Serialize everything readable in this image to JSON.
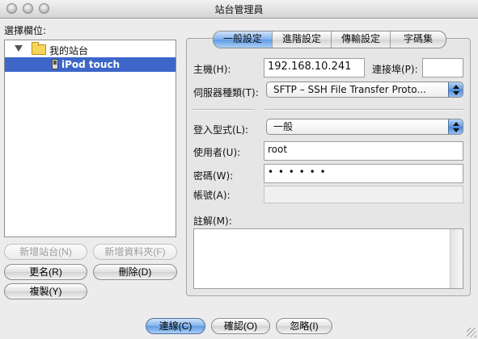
{
  "window": {
    "title": "站台管理員"
  },
  "left": {
    "select_entry_label": "選擇欄位:",
    "tree": [
      {
        "label": "我的站台",
        "icon": "folder-icon"
      },
      {
        "label": "iPod touch",
        "icon": "device-icon",
        "selected": true
      }
    ],
    "buttons": {
      "new_site": "新增站台(N)",
      "new_folder": "新增資料夾(F)",
      "rename": "更名(R)",
      "delete": "刪除(D)",
      "copy": "複製(Y)"
    }
  },
  "tabs": [
    "一般設定",
    "進階設定",
    "傳輸設定",
    "字碼集"
  ],
  "general": {
    "host_label": "主機(H):",
    "host_value": "192.168.10.241",
    "port_label": "連接埠(P):",
    "port_value": "",
    "server_type_label": "伺服器種類(T):",
    "server_type_value": "SFTP – SSH File Transfer Proto...",
    "logon_type_label": "登入型式(L):",
    "logon_type_value": "一般",
    "user_label": "使用者(U):",
    "user_value": "root",
    "password_label": "密碼(W):",
    "password_value": "• • • • • •",
    "account_label": "帳號(A):",
    "account_value": "",
    "comments_label": "註解(M):"
  },
  "footer": {
    "connect": "連線(C)",
    "ok": "確認(O)",
    "cancel": "忽略(I)"
  },
  "colors": {
    "selection": "#3d66c9",
    "default_button": "#6aa5e8"
  }
}
